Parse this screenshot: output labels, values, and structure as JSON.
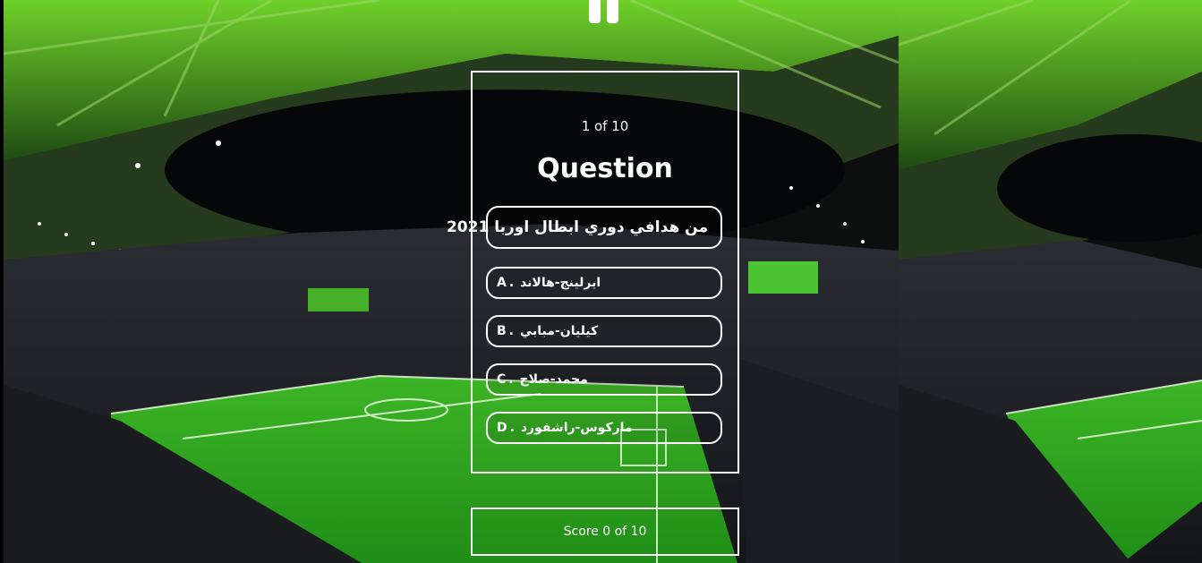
{
  "quiz": {
    "counter": "1 of 10",
    "heading": "Question",
    "question": "من هدافي دوري ابطال اوربا 2021",
    "options": [
      {
        "letter": "A",
        "text": "ايرلينج-هالاند"
      },
      {
        "letter": "B",
        "text": "كيليان-مبابي"
      },
      {
        "letter": "C",
        "text": "محمد-صلاح"
      },
      {
        "letter": "D",
        "text": "ماركوس-راشفورد"
      }
    ],
    "score": "Score 0 of 10"
  },
  "icons": {
    "pause": "pause-icon"
  },
  "colors": {
    "text": "#ffffff",
    "border": "#ffffff",
    "pitch": "#2fa61e",
    "roof_glow": "#5fc41f"
  }
}
